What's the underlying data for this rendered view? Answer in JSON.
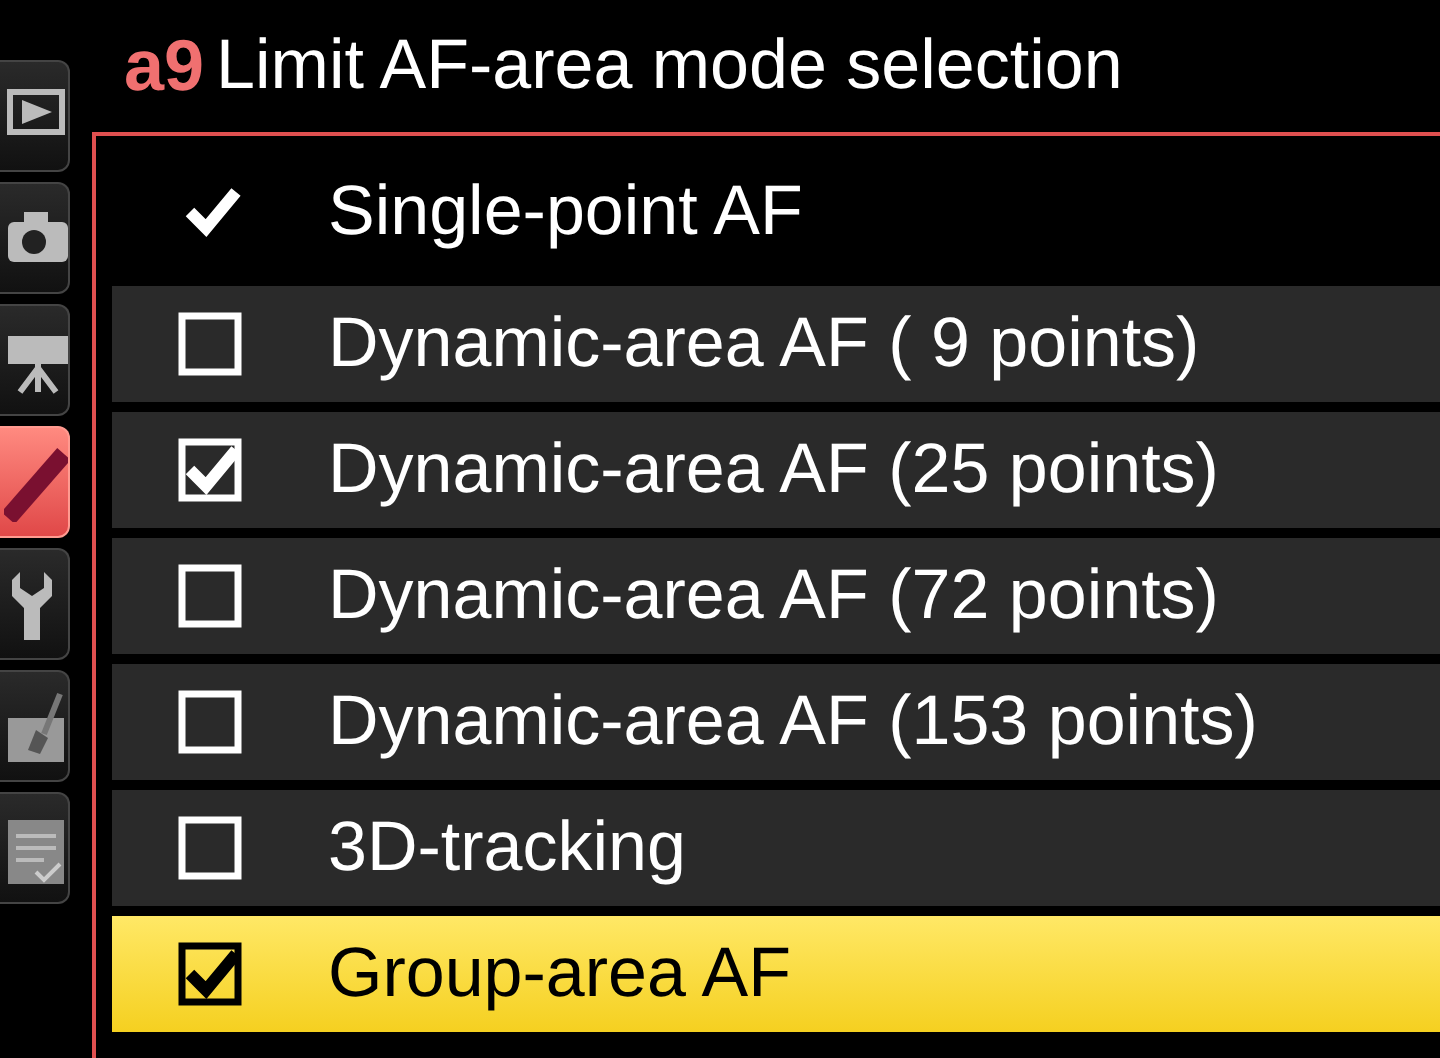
{
  "header": {
    "code": "a9",
    "title": "Limit AF-area mode selection"
  },
  "tabs": [
    {
      "kind": "playback",
      "selected": false
    },
    {
      "kind": "camera",
      "selected": false
    },
    {
      "kind": "movie",
      "selected": false
    },
    {
      "kind": "pencil",
      "selected": true
    },
    {
      "kind": "wrench",
      "selected": false
    },
    {
      "kind": "brush",
      "selected": false
    },
    {
      "kind": "list",
      "selected": false
    }
  ],
  "items": [
    {
      "kind": "fixed",
      "label": "Single-point AF",
      "checked": true,
      "selected": false
    },
    {
      "kind": "option",
      "label": "Dynamic-area AF ( 9 points)",
      "checked": false,
      "selected": false
    },
    {
      "kind": "option",
      "label": "Dynamic-area AF (25 points)",
      "checked": true,
      "selected": false
    },
    {
      "kind": "option",
      "label": "Dynamic-area AF (72 points)",
      "checked": false,
      "selected": false
    },
    {
      "kind": "option",
      "label": "Dynamic-area AF (153 points)",
      "checked": false,
      "selected": false
    },
    {
      "kind": "option",
      "label": "3D-tracking",
      "checked": false,
      "selected": false
    },
    {
      "kind": "option",
      "label": "Group-area AF",
      "checked": true,
      "selected": true
    }
  ]
}
